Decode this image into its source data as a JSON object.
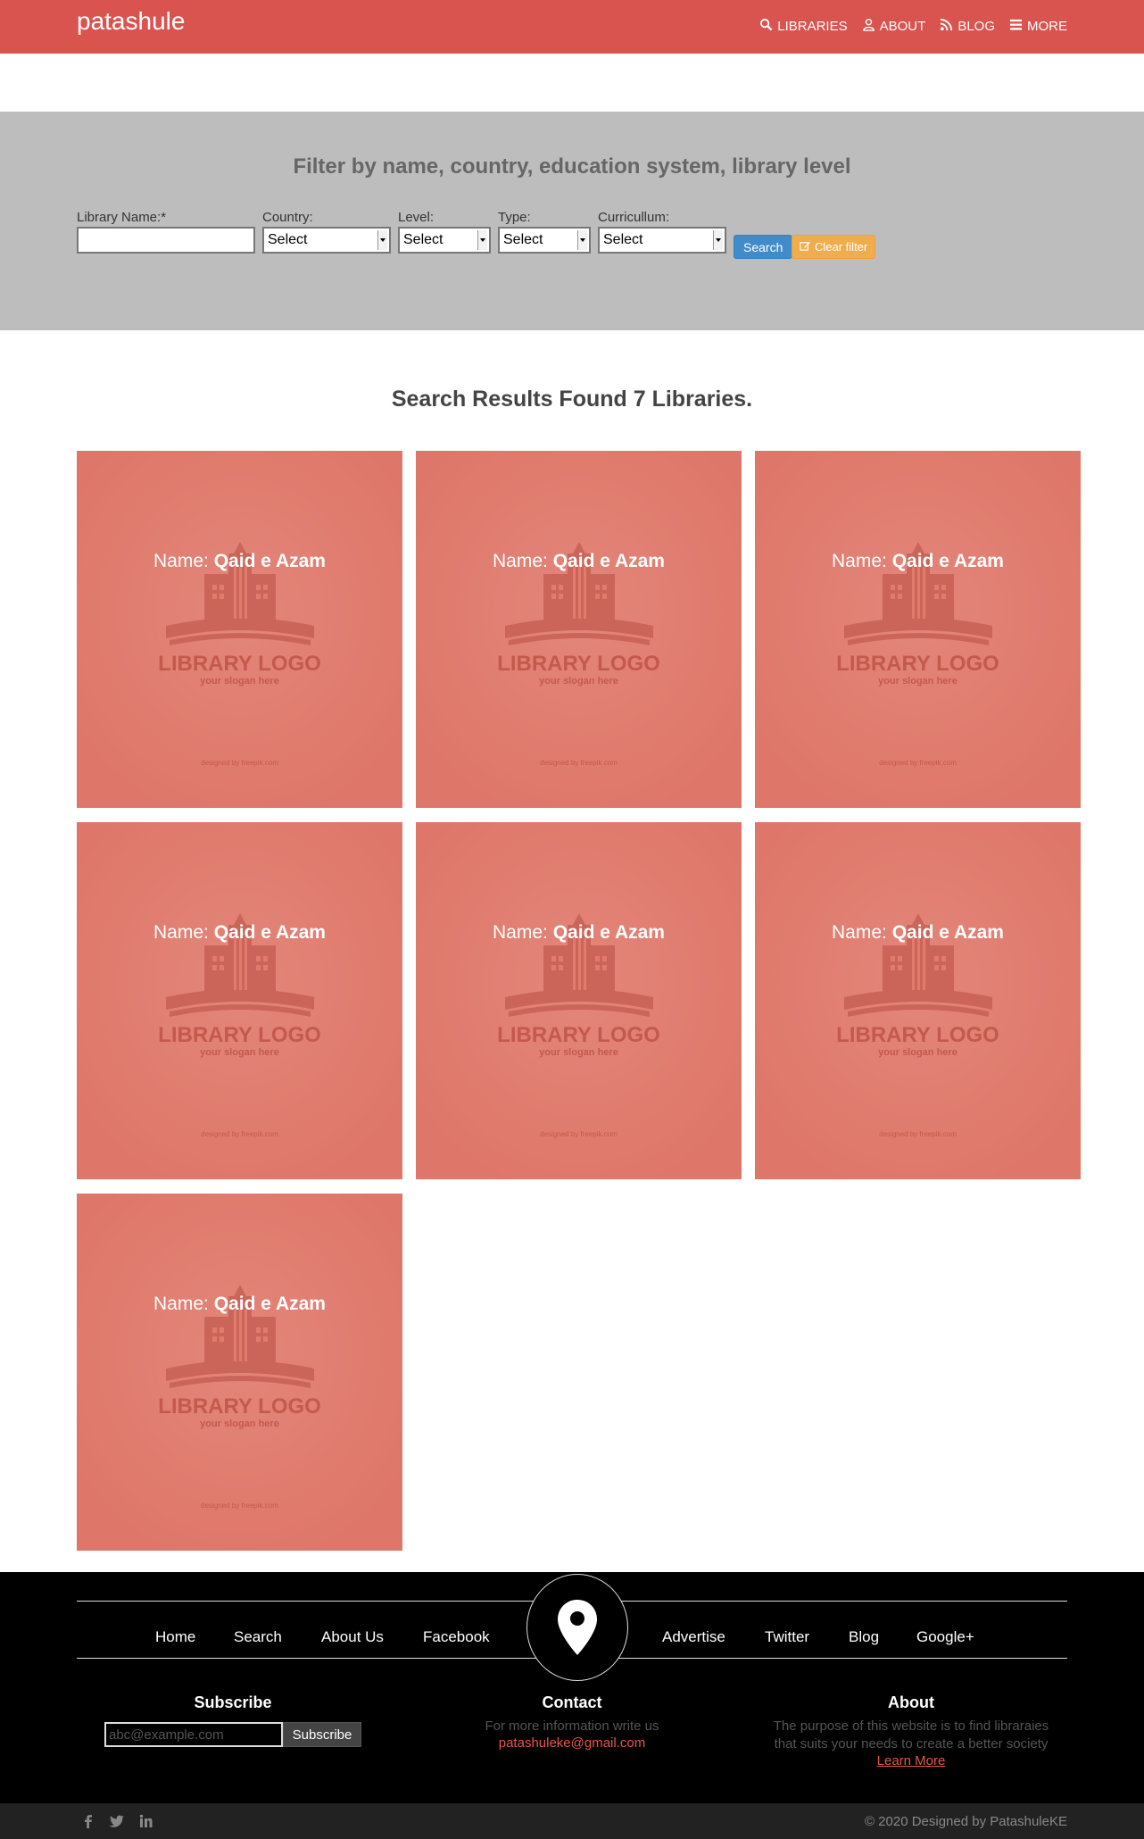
{
  "brand": "patashule",
  "nav": [
    {
      "label": "LIBRARIES",
      "icon": "search-icon"
    },
    {
      "label": "ABOUT",
      "icon": "user-icon"
    },
    {
      "label": "BLOG",
      "icon": "rss-icon"
    },
    {
      "label": "MORE",
      "icon": "menu-icon"
    }
  ],
  "filter": {
    "title": "Filter by name, country, education system, library level",
    "name_label": "Library Name:*",
    "name_value": "",
    "country_label": "Country:",
    "level_label": "Level:",
    "type_label": "Type:",
    "curriculum_label": "Curricullum:",
    "select_value": "Select",
    "search_label": "Search",
    "clear_label": "Clear filter"
  },
  "results": {
    "title": "Search Results Found 7 Libraries.",
    "name_prefix": "Name:",
    "cards": [
      {
        "name": "Qaid e Azam"
      },
      {
        "name": "Qaid e Azam"
      },
      {
        "name": "Qaid e Azam"
      },
      {
        "name": "Qaid e Azam"
      },
      {
        "name": "Qaid e Azam"
      },
      {
        "name": "Qaid e Azam"
      },
      {
        "name": "Qaid e Azam"
      }
    ],
    "logo_text": "LIBRARY LOGO",
    "logo_slogan": "your slogan here",
    "logo_credit": "designed by  freepik.com"
  },
  "footer": {
    "links_left": [
      "Home",
      "Search",
      "About Us",
      "Facebook"
    ],
    "links_right": [
      "Advertise",
      "Twitter",
      "Blog",
      "Google+"
    ],
    "subscribe_title": "Subscribe",
    "subscribe_placeholder": "abc@example.com",
    "subscribe_button": "Subscribe",
    "contact_title": "Contact",
    "contact_text": "For more information write us",
    "contact_email": "patashuleke@gmail.com",
    "about_title": "About",
    "about_line1": "The purpose of this website is to find libraraies",
    "about_line2": "that suits your needs to create a better society",
    "about_link": "Learn More",
    "copyright": "© 2020 Designed by PatashuleKE"
  },
  "colors": {
    "header": "#d9534f",
    "card": "#e07b6d",
    "filter_bg": "#bdbdbd",
    "footer": "#000000"
  }
}
